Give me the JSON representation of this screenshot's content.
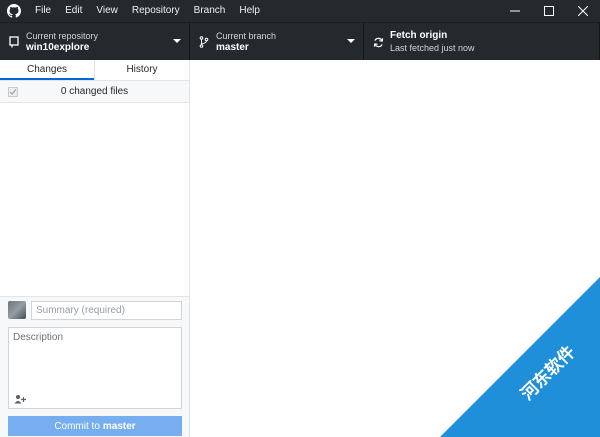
{
  "menu": {
    "items": [
      "File",
      "Edit",
      "View",
      "Repository",
      "Branch",
      "Help"
    ]
  },
  "window_controls": {
    "minimize_icon": "minimize-icon",
    "maximize_icon": "maximize-icon",
    "close_icon": "close-icon"
  },
  "toolbar": {
    "repository": {
      "label": "Current repository",
      "value": "win10explore",
      "icon": "repo-icon"
    },
    "branch": {
      "label": "Current branch",
      "value": "master",
      "icon": "branch-icon"
    },
    "fetch": {
      "label": "Fetch origin",
      "value": "Last fetched just now",
      "icon": "sync-icon"
    }
  },
  "sidebar": {
    "tabs": [
      {
        "label": "Changes",
        "active": true
      },
      {
        "label": "History",
        "active": false
      }
    ],
    "changes_count": "0 changed files"
  },
  "commit": {
    "summary_placeholder": "Summary (required)",
    "description_placeholder": "Description",
    "button_prefix": "Commit to",
    "button_branch": "master"
  },
  "colors": {
    "chrome": "#24292e",
    "accent": "#0366d6",
    "commit_button": "#77aef0",
    "watermark": "#1e8fd8"
  },
  "watermark": {
    "text": "河东软件"
  }
}
